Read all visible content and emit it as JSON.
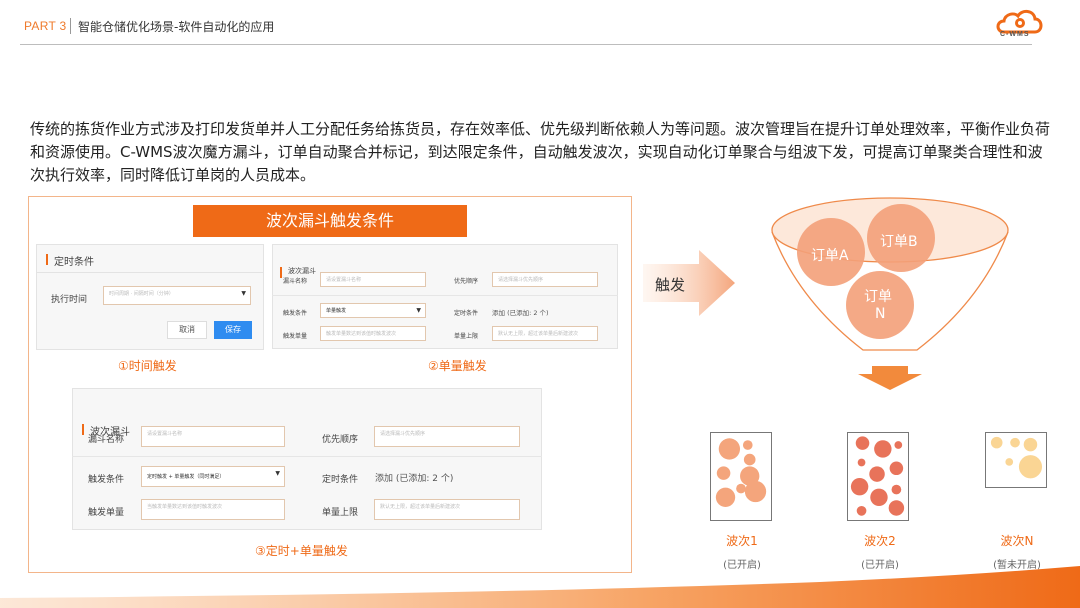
{
  "header": {
    "part": "PART 3",
    "title": "智能仓储优化场景-软件自动化的应用",
    "logo_text": "C-WMS"
  },
  "intro": "传统的拣货作业方式涉及打印发货单并人工分配任务给拣货员，存在效率低、优先级判断依赖人为等问题。波次管理旨在提升订单处理效率，平衡作业负荷和资源使用。C-WMS波次魔方漏斗，订单自动聚合并标记，到达限定条件，自动触发波次，实现自动化订单聚合与组波下发，可提高订单聚类合理性和波次执行效率，同时降低订单岗的人员成本。",
  "panel": {
    "title": "波次漏斗触发条件",
    "timer": {
      "heading": "定时条件",
      "exec_label": "执行时间",
      "exec_placeholder": "时间周期 · 间隔时间（分钟）",
      "cancel": "取消",
      "save": "保存",
      "caption": "①时间触发"
    },
    "single": {
      "heading": "波次漏斗",
      "name_label": "漏斗名称",
      "name_placeholder": "请设置漏斗名称",
      "priority_label": "优先顺序",
      "priority_placeholder": "请选择漏斗优先顺序",
      "trigger_label": "触发条件",
      "trigger_value": "单量触发",
      "timer_label": "定时条件",
      "timer_value": "添加  (已添加: 2 个)",
      "qty_label": "触发单量",
      "qty_placeholder": "触发单量数达到该值时触发波次",
      "limit_label": "单量上限",
      "limit_placeholder": "默认无上限，超过该单量后新建波次",
      "caption": "②单量触发"
    },
    "combo": {
      "heading": "波次漏斗",
      "name_label": "漏斗名称",
      "name_placeholder": "请设置漏斗名称",
      "priority_label": "优先顺序",
      "priority_placeholder": "请选择漏斗优先顺序",
      "trigger_label": "触发条件",
      "trigger_value": "定时触发 + 单量触发（同时满足）",
      "timer_label": "定时条件",
      "timer_value": "添加  (已添加: 2 个)",
      "qty_label": "触发单量",
      "qty_placeholder": "当触发单量数达到该值时触发波次",
      "limit_label": "单量上限",
      "limit_placeholder": "默认无上限，超过该单量后新建波次",
      "caption": "③定时+单量触发"
    }
  },
  "diagram": {
    "trigger": "触发",
    "orders": [
      "订单A",
      "订单B",
      "订单",
      "N"
    ],
    "waves": [
      {
        "label": "波次1",
        "status": "(已开启)"
      },
      {
        "label": "波次2",
        "status": "(已开启)"
      },
      {
        "label": "波次N",
        "status": "(暂未开启)"
      }
    ]
  },
  "colors": {
    "accent": "#ef6a17",
    "bubble": "#f4a57c",
    "wave2": "#e8735a",
    "waveN": "#fad594"
  }
}
